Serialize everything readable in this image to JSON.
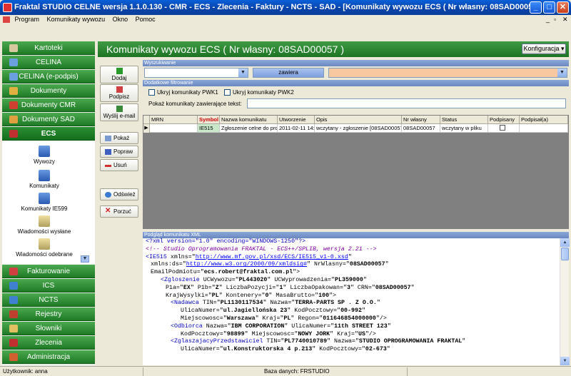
{
  "window": {
    "title": "Fraktal STUDIO CELNE  wersja 1.1.0.130 - CMR - ECS - Zlecenia - Faktury - NCTS - SAD - [Komunikaty wywozu ECS ( Nr własny: 08SAD00057 ) ]",
    "minimize": "_",
    "maximize": "□",
    "close": "✕"
  },
  "menu": {
    "items": [
      "Program",
      "Komunikaty wywozu",
      "Okno",
      "Pomoc"
    ],
    "mdi_min": "_",
    "mdi_max": "▫",
    "mdi_close": "✕"
  },
  "sidebar": {
    "items": [
      {
        "label": "Kartoteki",
        "icon": "address-book-icon",
        "color": "#d8c8a0"
      },
      {
        "label": "CELINA",
        "icon": "celina-icon",
        "color": "#6aa0e0"
      },
      {
        "label": "CELINA (e-podpis)",
        "icon": "celina-epodpis-icon",
        "color": "#6aa0e0"
      },
      {
        "label": "Dokumenty",
        "icon": "documents-icon",
        "color": "#e0b040"
      },
      {
        "label": "Dokumenty CMR",
        "icon": "cmr-icon",
        "color": "#d04030"
      },
      {
        "label": "Dokumenty SAD",
        "icon": "sad-icon",
        "color": "#e0a040"
      },
      {
        "label": "ECS",
        "icon": "ecs-icon",
        "color": "#c03030"
      },
      {
        "label": "Fakturowanie",
        "icon": "invoice-icon",
        "color": "#d04040"
      },
      {
        "label": "ICS",
        "icon": "ics-icon",
        "color": "#4080d0"
      },
      {
        "label": "NCTS",
        "icon": "ncts-icon",
        "color": "#4080d0"
      },
      {
        "label": "Rejestry",
        "icon": "registry-icon",
        "color": "#c04030"
      },
      {
        "label": "Słowniki",
        "icon": "dictionary-icon",
        "color": "#e0c060"
      },
      {
        "label": "Zlecenia",
        "icon": "orders-icon",
        "color": "#c03030"
      },
      {
        "label": "Administracja",
        "icon": "admin-icon",
        "color": "#d06030"
      }
    ],
    "ecs_subitems": [
      {
        "label": "Wywozy",
        "icon": "export-icon"
      },
      {
        "label": "Komunikaty",
        "icon": "messages-icon"
      },
      {
        "label": "Komunikaty IE599",
        "icon": "ie599-icon"
      },
      {
        "label": "Wiadomości wysłane",
        "icon": "sent-messages-icon"
      },
      {
        "label": "Wiadomości odebrane",
        "icon": "received-messages-icon"
      }
    ],
    "scroll_down": "▼"
  },
  "header": {
    "title": "Komunikaty wywozu ECS ( Nr własny: 08SAD00057 )",
    "config_button": "Konfiguracja ▾"
  },
  "actions": {
    "dodaj": "Dodaj",
    "podpisz": "Podpisz",
    "wyslij": "Wyślij e-mail",
    "pokaz": "Pokaż",
    "popraw": "Popraw",
    "usun": "Usuń",
    "odswiez": "Odśwież",
    "porzuc": "Porzuć"
  },
  "search": {
    "section_title": "Wyszukiwanie",
    "condition": "zawiera",
    "dd_arrow": "▼"
  },
  "filters": {
    "section_title": "Dodatkowe filtrowanie",
    "hide_pwk1": "Ukryj komunikaty PWK1",
    "hide_pwk2": "Ukryj komunikaty PWK2",
    "text_label": "Pokaż komunikaty zawierające tekst:"
  },
  "grid": {
    "columns": [
      "MRN",
      "Symbol",
      "Nazwa komunikatu",
      "Utworzenie",
      "Opis",
      "Nr własny",
      "Status",
      "Podpisany",
      "Podpisał(a)"
    ],
    "row_marker": "▶",
    "rows": [
      {
        "mrn": "",
        "symbol": "IE515",
        "nazwa": "Zgłoszenie celne do proc",
        "utworzenie": "2011-02-11 14:",
        "opis": "wczytany - zgłoszenie [08SAD00057]",
        "nr": "08SAD00057",
        "status": "wczytany w pliku",
        "podpisany": "",
        "podpisal": ""
      }
    ]
  },
  "xml": {
    "section_title": "Podgląd komunikatu XML",
    "lines": [
      {
        "indent": 0,
        "parts": [
          [
            "pi",
            "<?xml version=\"1.0\" encoding=\"WINDOWS-1250\"?>"
          ]
        ]
      },
      {
        "indent": 0,
        "parts": [
          [
            "cm",
            "<!-- Studio Oprogramowania FRAKTAL - ECS++/SPLIB, wersja 2.21 -->"
          ]
        ]
      },
      {
        "indent": 0,
        "parts": [
          [
            "tg",
            "<IE515"
          ],
          [
            "at",
            " xmlns=\""
          ],
          [
            "url",
            "http://www.mf.gov.pl/xsd/ECS/IE515_v1-0.xsd"
          ],
          [
            "at",
            "\""
          ]
        ]
      },
      {
        "indent": 1,
        "parts": [
          [
            "at",
            "xmlns:ds=\""
          ],
          [
            "url",
            "http://www.w3.org/2000/09/xmldsig#"
          ],
          [
            "at",
            "\" NrWlasny=\""
          ],
          [
            "av",
            "08SAD00057"
          ],
          [
            "at",
            "\""
          ]
        ]
      },
      {
        "indent": 1,
        "parts": [
          [
            "at",
            "EmailPodmiotu=\""
          ],
          [
            "av",
            "ecs.robert@fraktal.com.pl"
          ],
          [
            "at",
            "\">"
          ]
        ]
      },
      {
        "indent": 3,
        "parts": [
          [
            "tg",
            "<Zgloszenie"
          ],
          [
            "at",
            " UCWywozu=\""
          ],
          [
            "av",
            "PL443020"
          ],
          [
            "at",
            "\" UCWyprowadzenia=\""
          ],
          [
            "av",
            "PL359000"
          ],
          [
            "at",
            "\""
          ]
        ]
      },
      {
        "indent": 4,
        "parts": [
          [
            "at",
            "P1a=\""
          ],
          [
            "av",
            "EX"
          ],
          [
            "at",
            "\" P1b=\""
          ],
          [
            "av",
            "Z"
          ],
          [
            "at",
            "\" LiczbaPozycji=\""
          ],
          [
            "av",
            "1"
          ],
          [
            "at",
            "\" LiczbaOpakowan=\""
          ],
          [
            "av",
            "3"
          ],
          [
            "at",
            "\" CRN=\""
          ],
          [
            "av",
            "08SAD00057"
          ],
          [
            "at",
            "\""
          ]
        ]
      },
      {
        "indent": 4,
        "parts": [
          [
            "at",
            "KrajWysylki=\""
          ],
          [
            "av",
            "PL"
          ],
          [
            "at",
            "\" Kontenery=\""
          ],
          [
            "av",
            "0"
          ],
          [
            "at",
            "\" MasaBrutto=\""
          ],
          [
            "av",
            "100"
          ],
          [
            "at",
            "\">"
          ]
        ]
      },
      {
        "indent": 5,
        "parts": [
          [
            "tg",
            "<Nadawca"
          ],
          [
            "at",
            " TIN=\""
          ],
          [
            "av",
            "PL1130117534"
          ],
          [
            "at",
            "\" Nazwa=\""
          ],
          [
            "av",
            "TERRA-PARTS SP . Z O.O."
          ],
          [
            "at",
            "\""
          ]
        ]
      },
      {
        "indent": 7,
        "parts": [
          [
            "at",
            "UlicaNumer=\""
          ],
          [
            "av",
            "ul.Jagiellońska 23"
          ],
          [
            "at",
            "\" KodPocztowy=\""
          ],
          [
            "av",
            "00-992"
          ],
          [
            "at",
            "\""
          ]
        ]
      },
      {
        "indent": 7,
        "parts": [
          [
            "at",
            "Miejscowosc=\""
          ],
          [
            "av",
            "Warszawa"
          ],
          [
            "at",
            "\" Kraj=\""
          ],
          [
            "av",
            "PL"
          ],
          [
            "at",
            "\" Regon=\""
          ],
          [
            "av",
            "011646854000000"
          ],
          [
            "at",
            "\"/>"
          ]
        ]
      },
      {
        "indent": 5,
        "parts": [
          [
            "tg",
            "<Odbiorca"
          ],
          [
            "at",
            " Nazwa=\""
          ],
          [
            "av",
            "IBM CORPORATION"
          ],
          [
            "at",
            "\" UlicaNumer=\""
          ],
          [
            "av",
            "11th STREET 123"
          ],
          [
            "at",
            "\""
          ]
        ]
      },
      {
        "indent": 7,
        "parts": [
          [
            "at",
            "KodPocztowy=\""
          ],
          [
            "av",
            "98899"
          ],
          [
            "at",
            "\" Miejscowosc=\""
          ],
          [
            "av",
            "NOWY JORK"
          ],
          [
            "at",
            "\" Kraj=\""
          ],
          [
            "av",
            "US"
          ],
          [
            "at",
            "\"/>"
          ]
        ]
      },
      {
        "indent": 5,
        "parts": [
          [
            "tg",
            "<ZglaszajacyPrzedstawiciel"
          ],
          [
            "at",
            " TIN=\""
          ],
          [
            "av",
            "PL7740010789"
          ],
          [
            "at",
            "\" Nazwa=\""
          ],
          [
            "av",
            "STUDIO OPROGRAMOWANIA FRAKTAL"
          ],
          [
            "at",
            "\""
          ]
        ]
      },
      {
        "indent": 7,
        "parts": [
          [
            "at",
            "UlicaNumer=\""
          ],
          [
            "av",
            "ul.Konstruktorska 4 p.213"
          ],
          [
            "at",
            "\" KodPocztowy=\""
          ],
          [
            "av",
            "02-673"
          ],
          [
            "at",
            "\""
          ]
        ]
      }
    ]
  },
  "status": {
    "user": "Użytkownik: anna",
    "db": "Baza danych: FRSTUDIO"
  },
  "colors": {
    "accent_green": "#1d7424",
    "search_field": "#f8c9a0"
  }
}
